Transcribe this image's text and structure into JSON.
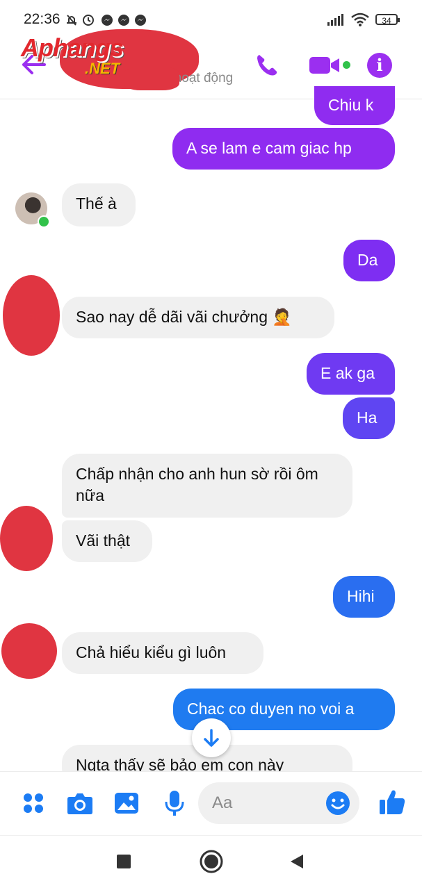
{
  "status_bar": {
    "time": "22:36",
    "notification_icons": "bell-off, alarm, messenger, messenger, messenger",
    "battery": "34"
  },
  "header": {
    "watermark_logo": "Aphangs",
    "watermark_net": ".NET",
    "subtitle": "Đang hoạt động",
    "accent_color": "#9b2ff0",
    "icons": [
      "back-arrow-icon",
      "phone-icon",
      "video-camera-icon",
      "info-icon"
    ]
  },
  "messages": [
    {
      "direction": "out",
      "text": "Chiu k"
    },
    {
      "direction": "out",
      "text": "A se lam e cam giac hp"
    },
    {
      "direction": "in",
      "text": "Thế à"
    },
    {
      "direction": "out",
      "text": "Da"
    },
    {
      "direction": "in",
      "text": "Sao nay dễ dãi vãi chưởng 🤦"
    },
    {
      "direction": "out",
      "text": "E ak ga"
    },
    {
      "direction": "out",
      "text": "Ha"
    },
    {
      "direction": "in",
      "text": "Chấp nhận cho anh hun sờ rồi ôm nữa"
    },
    {
      "direction": "in",
      "text": "Vãi thật"
    },
    {
      "direction": "out",
      "text": "Hihi"
    },
    {
      "direction": "in",
      "text": "Chả hiểu kiểu gì luôn"
    },
    {
      "direction": "out",
      "text": "Chac co duyen no voi a"
    },
    {
      "direction": "in",
      "text": "Ngta thấy sẽ bảo em con này"
    }
  ],
  "composer": {
    "placeholder": "Aa",
    "icons": [
      "apps-icon",
      "camera-icon",
      "image-icon",
      "microphone-icon",
      "emoji-icon",
      "thumbs-up-icon"
    ]
  },
  "nav_bar": {
    "icons": [
      "recent-apps-icon",
      "home-icon",
      "back-icon"
    ]
  },
  "colors": {
    "bubble_out_purple": "#8a2cf2",
    "bubble_out_blue": "#1f7bf0",
    "bubble_in": "#f0f0f0",
    "redaction": "#e03541",
    "composer_icon": "#1c7cf4"
  }
}
